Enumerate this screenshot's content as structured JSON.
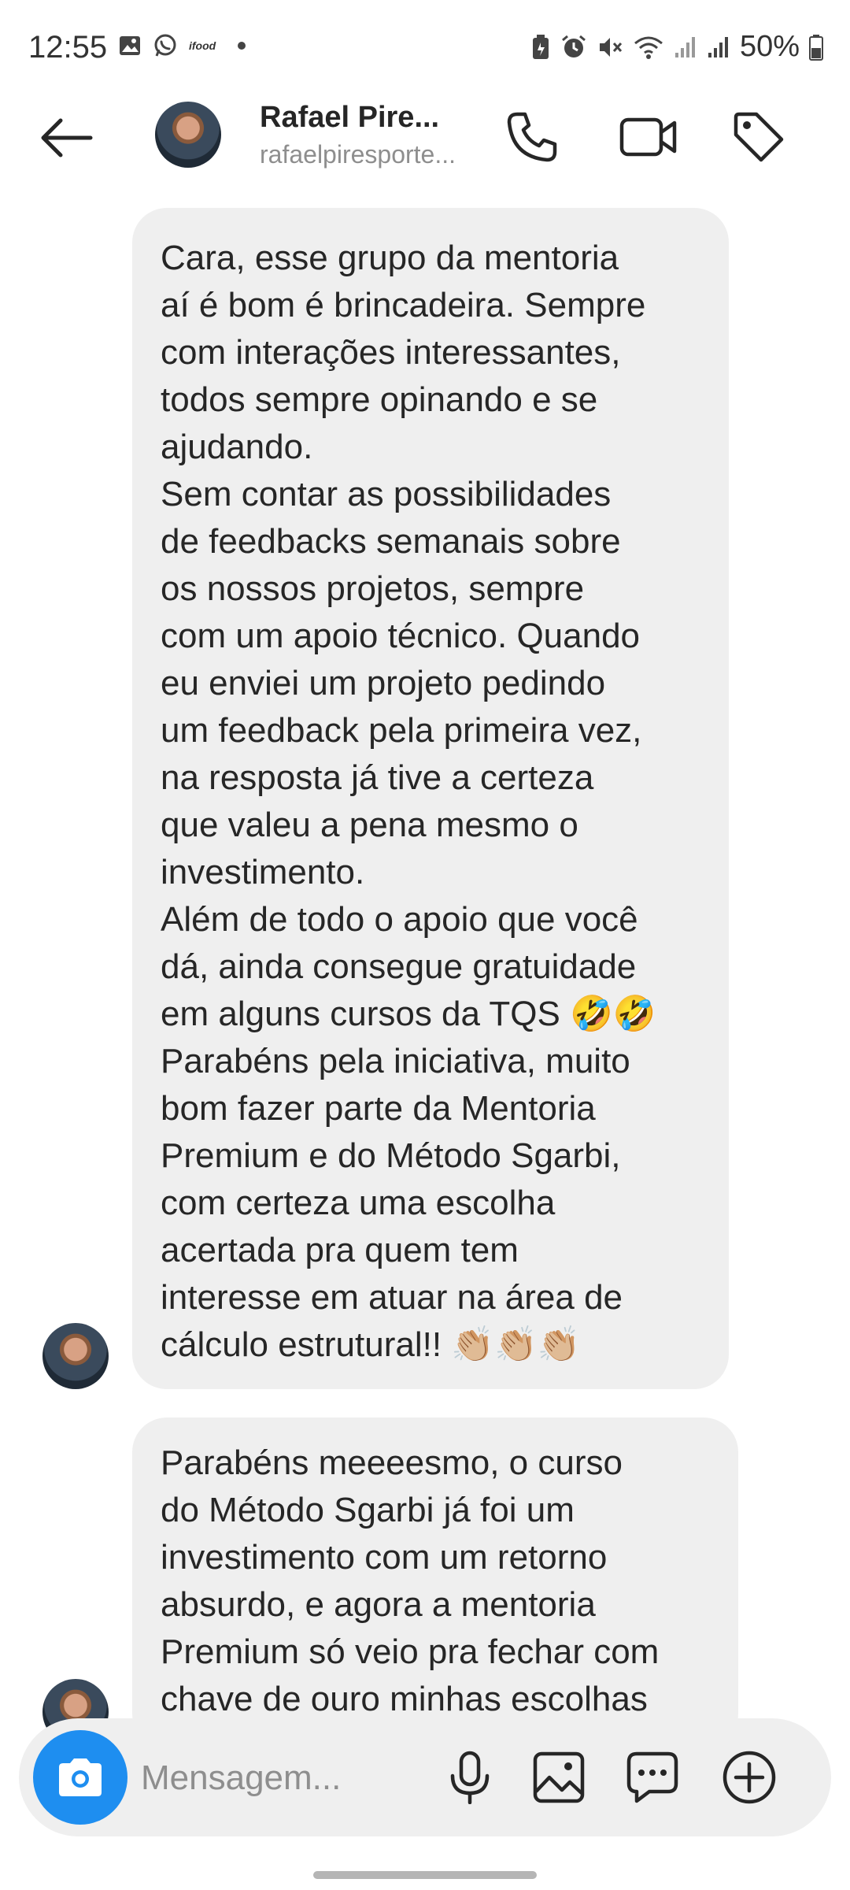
{
  "status_bar": {
    "time": "12:55",
    "ifood_label": "ifood",
    "battery": "50%"
  },
  "header": {
    "name": "Rafael Pire...",
    "username": "rafaelpiresporte..."
  },
  "messages": [
    {
      "text": "Cara, esse grupo da mentoria\naí é bom é brincadeira. Sempre\ncom interações interessantes,\ntodos sempre opinando e se\najudando.\nSem contar as possibilidades\nde feedbacks semanais sobre\nos nossos projetos, sempre\ncom um apoio técnico. Quando\neu enviei um projeto pedindo\num feedback pela primeira vez,\nna resposta já tive a certeza\nque valeu a pena mesmo o\ninvestimento.\nAlém de todo o apoio que você\ndá, ainda consegue gratuidade\nem alguns cursos da TQS 🤣🤣\nParabéns pela iniciativa, muito\nbom fazer parte da Mentoria\nPremium e do Método Sgarbi,\ncom certeza uma escolha\nacertada pra quem tem\ninteresse em atuar na área de\ncálculo estrutural!! 👏🏼👏🏼👏🏼"
    },
    {
      "text": "Parabéns meeeesmo, o curso\ndo Método Sgarbi já foi um\ninvestimento com um retorno\nabsurdo, e agora a mentoria\nPremium só veio pra fechar com\nchave de ouro minhas escolhas"
    }
  ],
  "composer": {
    "placeholder": "Mensagem..."
  }
}
